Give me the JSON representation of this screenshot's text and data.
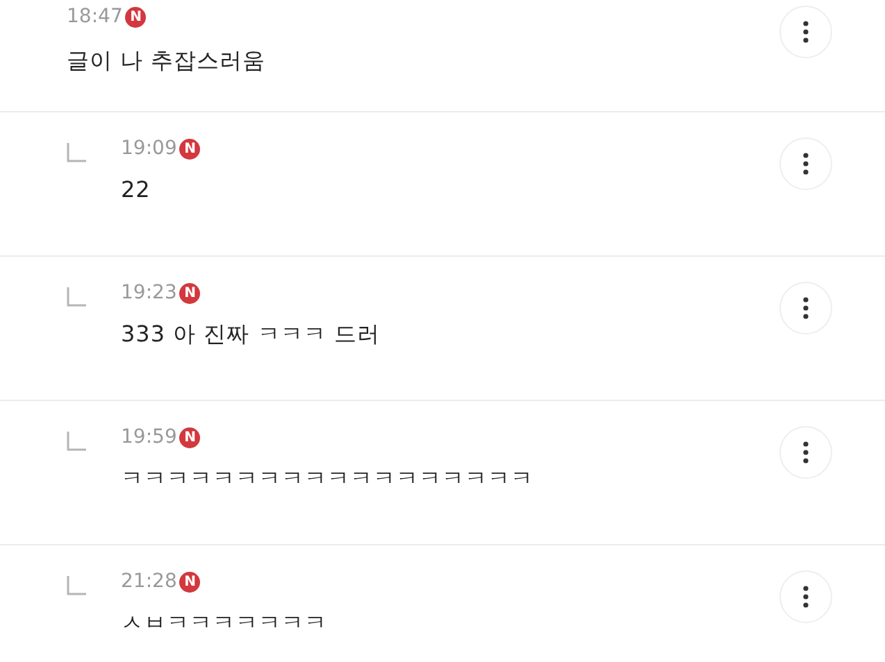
{
  "comments": [
    {
      "kind": "comment",
      "time": "18:47",
      "badge": "N",
      "text": "글이    나 추잡스러움"
    },
    {
      "kind": "reply",
      "time": "19:09",
      "badge": "N",
      "text": "22"
    },
    {
      "kind": "reply",
      "time": "19:23",
      "badge": "N",
      "text": "333 아 진짜 ㅋㅋㅋ 드러"
    },
    {
      "kind": "reply",
      "time": "19:59",
      "badge": "N",
      "text": "ㅋㅋㅋㅋㅋㅋㅋㅋㅋㅋㅋㅋㅋㅋㅋㅋㅋㅋ"
    },
    {
      "kind": "reply",
      "time": "21:28",
      "badge": "N",
      "text": "ㅅㅂㅋㅋㅋㅋㅋㅋㅋ"
    }
  ]
}
